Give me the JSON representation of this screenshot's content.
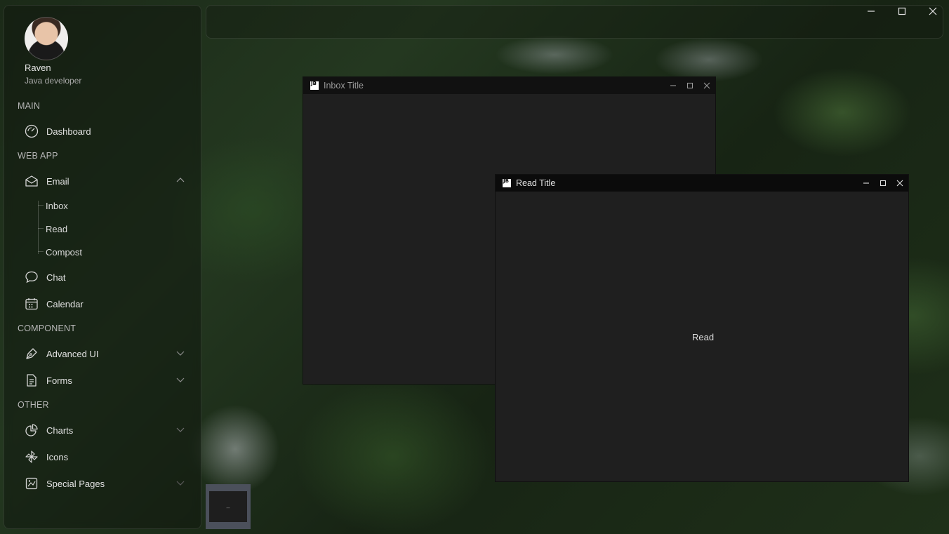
{
  "window": {
    "controls": [
      "minimize",
      "maximize",
      "close"
    ]
  },
  "profile": {
    "name": "Raven",
    "role": "Java developer"
  },
  "sections": {
    "main": "MAIN",
    "web_app": "WEB APP",
    "component": "COMPONENT",
    "other": "OTHER"
  },
  "menu": {
    "dashboard": {
      "label": "Dashboard",
      "icon": "dashboard-gauge-icon"
    },
    "email": {
      "label": "Email",
      "icon": "envelope-icon",
      "expanded": true,
      "children": [
        "Inbox",
        "Read",
        "Compost"
      ]
    },
    "chat": {
      "label": "Chat",
      "icon": "chat-bubble-icon"
    },
    "calendar": {
      "label": "Calendar",
      "icon": "calendar-icon"
    },
    "advanced_ui": {
      "label": "Advanced UI",
      "icon": "pen-nib-icon"
    },
    "forms": {
      "label": "Forms",
      "icon": "document-icon"
    },
    "charts": {
      "label": "Charts",
      "icon": "pie-chart-icon"
    },
    "icons": {
      "label": "Icons",
      "icon": "pinwheel-icon"
    },
    "special_pages": {
      "label": "Special Pages",
      "icon": "special-pages-icon"
    }
  },
  "frames": {
    "inbox": {
      "title": "Inbox Title",
      "badge": "JB"
    },
    "read": {
      "title": "Read Title",
      "badge": "JB",
      "content": "Read"
    }
  },
  "taskbar": {
    "thumbnail_label": "–"
  },
  "colors": {
    "frame_background": "#1f1f1f",
    "frame_titlebar": "#111111",
    "sidebar_text": "#e2e2e2"
  }
}
